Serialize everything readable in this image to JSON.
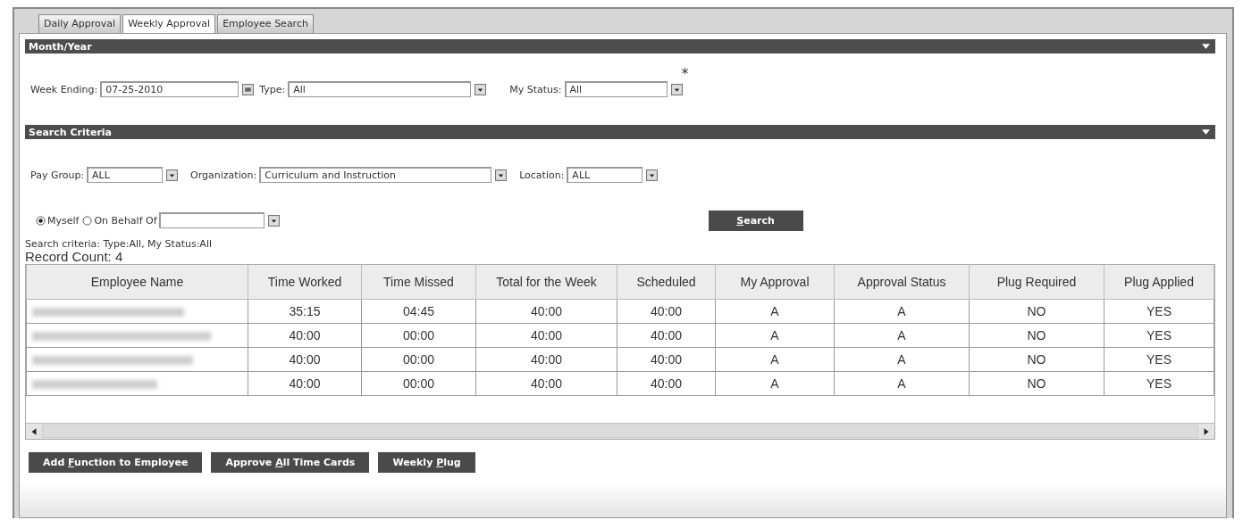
{
  "tabs": [
    {
      "label": "Daily Approval",
      "selected": false
    },
    {
      "label": "Weekly Approval",
      "selected": true
    },
    {
      "label": "Employee Search",
      "selected": false
    }
  ],
  "month_year": {
    "title": "Month/Year",
    "expanded": true,
    "fields": [
      {
        "label": "Week Ending:",
        "value": "07-25-2010",
        "kind": "date"
      },
      {
        "label": "Type:",
        "value": "All",
        "kind": "select"
      },
      {
        "label": "My Status:",
        "value": "All",
        "kind": "select",
        "required_mark": "*"
      }
    ]
  },
  "search_criteria": {
    "title": "Search Criteria",
    "expanded": true,
    "fields": [
      {
        "label": "Pay Group:",
        "value": "ALL"
      },
      {
        "label": "Organization:",
        "value": "Curriculum and Instruction"
      },
      {
        "label": "Location:",
        "value": "ALL"
      }
    ],
    "radios": [
      {
        "label": "Myself",
        "selected": true
      },
      {
        "label": "On Behalf Of",
        "selected": false
      }
    ],
    "search_button": {
      "label_parts": [
        {
          "text": "S",
          "underline": true
        },
        {
          "text": "earch",
          "underline": false
        }
      ]
    }
  },
  "summary": "Search criteria: Type:All, My Status:All",
  "record_count": "Record Count: 4",
  "table": {
    "name_column": "Employee Name",
    "columns": [
      "Time Worked",
      "Time Missed",
      "Total for the Week",
      "Scheduled",
      "My Approval",
      "Approval Status",
      "Plug Required",
      "Plug Applied"
    ],
    "rows": [
      [
        "35:15",
        "04:45",
        "40:00",
        "40:00",
        "A",
        "A",
        "NO",
        "YES"
      ],
      [
        "40:00",
        "00:00",
        "40:00",
        "40:00",
        "A",
        "A",
        "NO",
        "YES"
      ],
      [
        "40:00",
        "00:00",
        "40:00",
        "40:00",
        "A",
        "A",
        "NO",
        "YES"
      ],
      [
        "40:00",
        "00:00",
        "40:00",
        "40:00",
        "A",
        "A",
        "NO",
        "YES"
      ]
    ]
  },
  "buttons": [
    {
      "label_parts": [
        {
          "text": "Add ",
          "underline": false
        },
        {
          "text": "F",
          "underline": true
        },
        {
          "text": "unction to Employee",
          "underline": false
        }
      ]
    },
    {
      "label_parts": [
        {
          "text": "Approve ",
          "underline": false
        },
        {
          "text": "A",
          "underline": true
        },
        {
          "text": "ll Time Cards",
          "underline": false
        }
      ]
    },
    {
      "label_parts": [
        {
          "text": "Weekly ",
          "underline": false
        },
        {
          "text": "P",
          "underline": true
        },
        {
          "text": "lug",
          "underline": false
        }
      ]
    }
  ]
}
